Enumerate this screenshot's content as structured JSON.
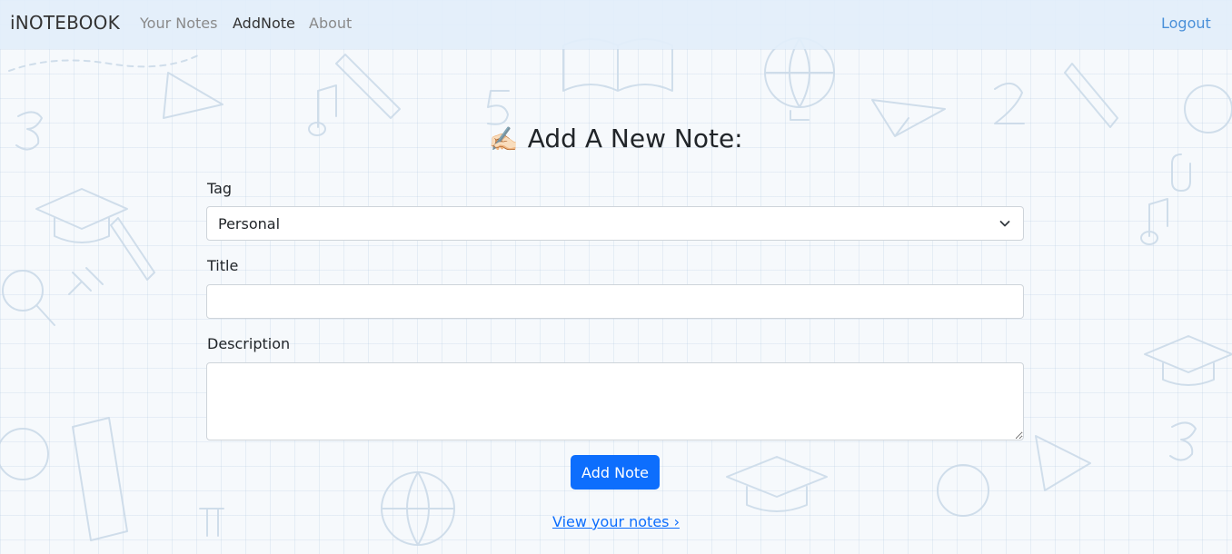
{
  "navbar": {
    "brand": "iNOTEBOOK",
    "links": [
      {
        "label": "Your Notes",
        "active": false
      },
      {
        "label": "AddNote",
        "active": true
      },
      {
        "label": "About",
        "active": false
      }
    ],
    "logout": "Logout"
  },
  "form": {
    "heading_icon": "✍🏻",
    "heading": "Add A New Note:",
    "tag_label": "Tag",
    "tag_value": "Personal",
    "title_label": "Title",
    "title_value": "",
    "description_label": "Description",
    "description_value": "",
    "submit_label": "Add Note"
  },
  "footer_link": "View your notes ›",
  "colors": {
    "primary": "#0d6efd",
    "navbar_bg": "#e2eefa",
    "logout": "#4a90d9"
  },
  "icons": {
    "tag_select_arrow": "chevron-down-icon",
    "heading": "writing-hand-icon"
  }
}
